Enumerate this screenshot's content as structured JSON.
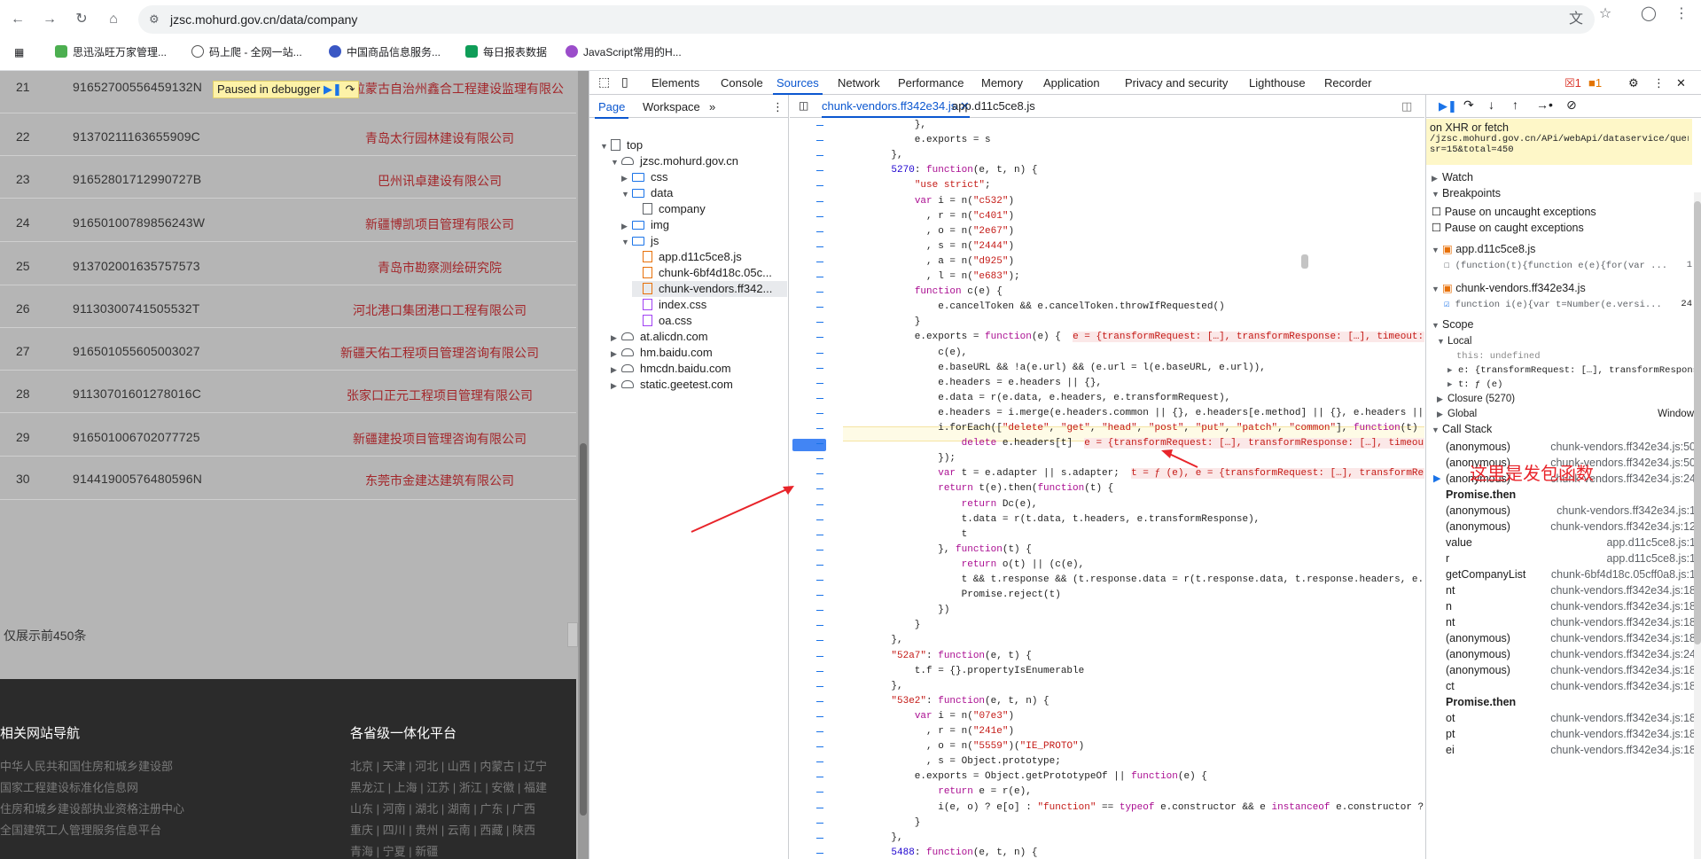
{
  "browser": {
    "url": "jzsc.mohurd.gov.cn/data/company",
    "bookmarks": [
      "思迅泓旺万家管理...",
      "码上爬 - 全网一站...",
      "中国商品信息服务...",
      "每日报表数据",
      "JavaScript常用的H..."
    ]
  },
  "page": {
    "rows": [
      {
        "idx": "21",
        "code": "91652700556459132N",
        "name": "博尔塔拉蒙古自治州鑫合工程建设监理有限公"
      },
      {
        "idx": "22",
        "code": "91370211163655909C",
        "name": "青岛太行园林建设有限公司"
      },
      {
        "idx": "23",
        "code": "91652801712990727B",
        "name": "巴州讯卓建设有限公司"
      },
      {
        "idx": "24",
        "code": "91650100789856243W",
        "name": "新疆博凯项目管理有限公司"
      },
      {
        "idx": "25",
        "code": "913702001635757573",
        "name": "青岛市勘察测绘研究院"
      },
      {
        "idx": "26",
        "code": "91130300741505532T",
        "name": "河北港口集团港口工程有限公司"
      },
      {
        "idx": "27",
        "code": "916501055605003027",
        "name": "新疆天佑工程项目管理咨询有限公司"
      },
      {
        "idx": "28",
        "code": "91130701601278016C",
        "name": "张家口正元工程项目管理有限公司"
      },
      {
        "idx": "29",
        "code": "916501006702077725",
        "name": "新疆建投项目管理咨询有限公司"
      },
      {
        "idx": "30",
        "code": "91441900576480596N",
        "name": "东莞市金建达建筑有限公司"
      }
    ],
    "total_note": "仅展示前450条",
    "paused_label": "Paused in debugger",
    "footer": {
      "nav_title": "相关网站导航",
      "prov_title": "各省级一体化平台",
      "links": [
        "中华人民共和国住房和城乡建设部",
        "国家工程建设标准化信息网",
        "住房和城乡建设部执业资格注册中心",
        "全国建筑工人管理服务信息平台"
      ],
      "provs": [
        "北京 | 天津 | 河北 | 山西 | 内蒙古 | 辽宁",
        "黑龙江 | 上海 | 江苏 | 浙江 | 安徽 | 福建",
        "山东 | 河南 | 湖北 | 湖南 | 广东 | 广西",
        "重庆 | 四川 | 贵州 | 云南 | 西藏 | 陕西",
        "青海 | 宁夏 | 新疆"
      ]
    }
  },
  "devtools": {
    "tabs": [
      "Elements",
      "Console",
      "Sources",
      "Network",
      "Performance",
      "Memory",
      "Application",
      "Privacy and security",
      "Lighthouse",
      "Recorder"
    ],
    "active_tab": "Sources",
    "errors": "1",
    "warnings": "1",
    "nav_tabs": [
      "Page",
      "Workspace"
    ],
    "tree": [
      "top",
      "jzsc.mohurd.gov.cn",
      "css",
      "data",
      "company",
      "img",
      "js",
      "app.d11c5ce8.js",
      "chunk-6bf4d18c.05c...",
      "chunk-vendors.ff342...",
      "index.css",
      "oa.css",
      "at.alicdn.com",
      "hm.baidu.com",
      "hmcdn.baidu.com",
      "static.geetest.com"
    ],
    "editor_tabs": [
      "chunk-vendors.ff342e34.js",
      "app.d11c5ce8.js"
    ],
    "xhr": {
      "title": "on XHR or fetch",
      "url1": "/jzsc.mohurd.gov.cn/APi/webApi/dataservice/query/c",
      "url2": "sr=15&total=450"
    },
    "sections": {
      "watch": "Watch",
      "breakpoints": "Breakpoints",
      "scope": "Scope",
      "local": "Local",
      "closure": "Closure (5270)",
      "global": "Global",
      "global_val": "Window",
      "callstack": "Call Stack"
    },
    "pause_uncaught": "Pause on uncaught exceptions",
    "pause_caught": "Pause on caught exceptions",
    "bp_files": [
      {
        "file": "app.d11c5ce8.js",
        "code": "(function(t){function e(e){for(var ...",
        "line": "1"
      },
      {
        "file": "chunk-vendors.ff342e34.js",
        "code": "function i(e){var t=Number(e.versi...",
        "line": "24"
      }
    ],
    "scope_local": [
      "this: undefined",
      "e: {transformRequest: […], transformRespons",
      "t: ƒ (e)"
    ],
    "callstack": [
      {
        "fn": "(anonymous)",
        "loc": "chunk-vendors.ff342e34.js:50"
      },
      {
        "fn": "(anonymous)",
        "loc": "chunk-vendors.ff342e34.js:50"
      },
      {
        "fn": "(anonymous)",
        "loc": "chunk-vendors.ff342e34.js:24"
      },
      {
        "fn": "Promise.then",
        "loc": ""
      },
      {
        "fn": "(anonymous)",
        "loc": "chunk-vendors.ff342e34.js:1"
      },
      {
        "fn": "(anonymous)",
        "loc": "chunk-vendors.ff342e34.js:12"
      },
      {
        "fn": "value",
        "loc": "app.d11c5ce8.js:1"
      },
      {
        "fn": "r",
        "loc": "app.d11c5ce8.js:1"
      },
      {
        "fn": "getCompanyList",
        "loc": "chunk-6bf4d18c.05cff0a8.js:1"
      },
      {
        "fn": "nt",
        "loc": "chunk-vendors.ff342e34.js:18"
      },
      {
        "fn": "n",
        "loc": "chunk-vendors.ff342e34.js:18"
      },
      {
        "fn": "nt",
        "loc": "chunk-vendors.ff342e34.js:18"
      },
      {
        "fn": "(anonymous)",
        "loc": "chunk-vendors.ff342e34.js:18"
      },
      {
        "fn": "(anonymous)",
        "loc": "chunk-vendors.ff342e34.js:24"
      },
      {
        "fn": "(anonymous)",
        "loc": "chunk-vendors.ff342e34.js:18"
      },
      {
        "fn": "ct",
        "loc": "chunk-vendors.ff342e34.js:18"
      },
      {
        "fn": "Promise.then",
        "loc": ""
      },
      {
        "fn": "ot",
        "loc": "chunk-vendors.ff342e34.js:18"
      },
      {
        "fn": "pt",
        "loc": "chunk-vendors.ff342e34.js:18"
      },
      {
        "fn": "ei",
        "loc": "chunk-vendors.ff342e34.js:18"
      }
    ],
    "annotation": "这里是发包函数"
  }
}
